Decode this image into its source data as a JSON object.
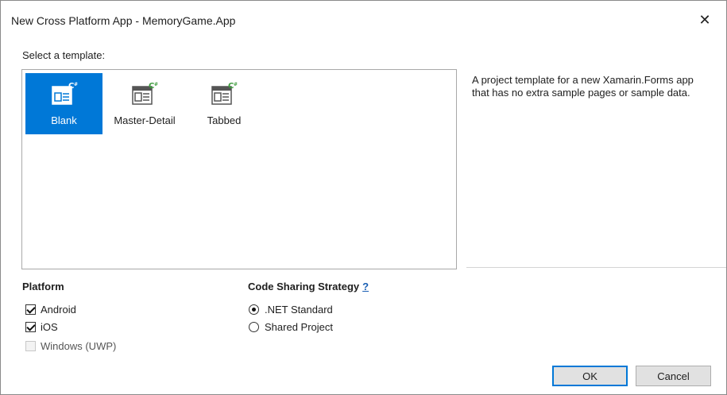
{
  "window": {
    "title": "New Cross Platform App - MemoryGame.App",
    "close_glyph": "✕"
  },
  "template_section": {
    "label": "Select a template:"
  },
  "templates": [
    {
      "label": "Blank",
      "icon": "blank-template-icon",
      "selected": true
    },
    {
      "label": "Master-Detail",
      "icon": "master-detail-template-icon",
      "selected": false
    },
    {
      "label": "Tabbed",
      "icon": "tabbed-template-icon",
      "selected": false
    }
  ],
  "description": "A project template for a new Xamarin.Forms app that has no extra sample pages or sample data.",
  "platform": {
    "heading": "Platform",
    "options": [
      {
        "label": "Android",
        "checked": true,
        "enabled": true
      },
      {
        "label": "iOS",
        "checked": true,
        "enabled": true
      },
      {
        "label": "Windows (UWP)",
        "checked": false,
        "enabled": false
      }
    ]
  },
  "code_sharing": {
    "heading": "Code Sharing Strategy",
    "help": "?",
    "options": [
      {
        "label": ".NET Standard",
        "selected": true
      },
      {
        "label": "Shared Project",
        "selected": false
      }
    ]
  },
  "buttons": {
    "ok": "OK",
    "cancel": "Cancel"
  },
  "colors": {
    "selection": "#0078d7",
    "icon_green": "#3a9a3a",
    "link": "#1a5fb4"
  }
}
